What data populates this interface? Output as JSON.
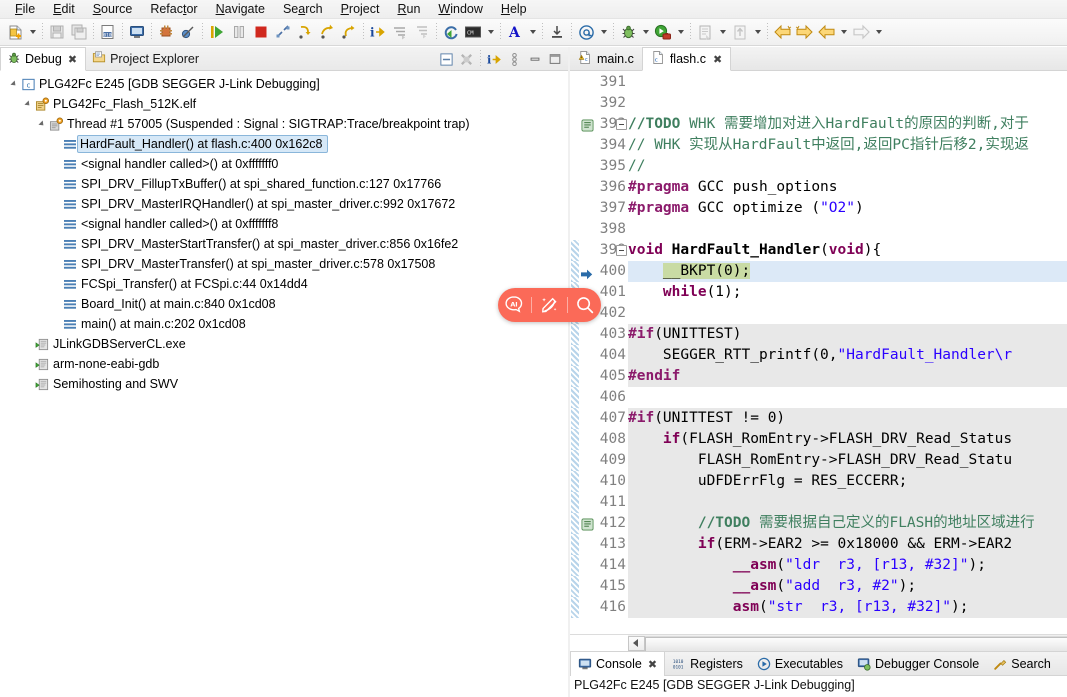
{
  "menubar": {
    "items": [
      {
        "label": "File",
        "mnemonic": "F"
      },
      {
        "label": "Edit",
        "mnemonic": "E"
      },
      {
        "label": "Source",
        "mnemonic": "S"
      },
      {
        "label": "Refactor",
        "mnemonic": "t"
      },
      {
        "label": "Navigate",
        "mnemonic": "N"
      },
      {
        "label": "Search",
        "mnemonic": "a"
      },
      {
        "label": "Project",
        "mnemonic": "P"
      },
      {
        "label": "Run",
        "mnemonic": "R"
      },
      {
        "label": "Window",
        "mnemonic": "W"
      },
      {
        "label": "Help",
        "mnemonic": "H"
      }
    ]
  },
  "toolbar": {
    "buttons": [
      {
        "name": "new-wizard-icon",
        "title": "New"
      },
      {
        "name": "save-icon",
        "title": "Save"
      },
      {
        "name": "save-all-icon",
        "title": "Save All"
      },
      {
        "name": "build-icon",
        "title": "Build"
      },
      {
        "name": "console-icon",
        "title": "Open Console"
      },
      {
        "name": "registers-icon",
        "title": "Registers"
      },
      {
        "name": "skip-breakpoints-icon",
        "title": "Skip All Breakpoints"
      },
      {
        "name": "resume-icon",
        "title": "Resume"
      },
      {
        "name": "suspend-icon",
        "title": "Suspend"
      },
      {
        "name": "terminate-icon",
        "title": "Terminate"
      },
      {
        "name": "disconnect-icon",
        "title": "Disconnect"
      },
      {
        "name": "step-into-icon",
        "title": "Step Into"
      },
      {
        "name": "step-over-icon",
        "title": "Step Over"
      },
      {
        "name": "step-return-icon",
        "title": "Step Return"
      },
      {
        "name": "instruction-stepping-icon",
        "title": "Instruction Stepping Mode"
      },
      {
        "name": "step-into-selection-icon",
        "title": "Step Into Selection"
      },
      {
        "name": "drop-to-frame-icon",
        "title": "Drop To Frame"
      },
      {
        "name": "refresh-icon",
        "title": "Refresh"
      },
      {
        "name": "terminal-icon",
        "title": "Open a Terminal"
      },
      {
        "name": "annotation-icon",
        "title": "Toggle Annotations"
      },
      {
        "name": "export-icon",
        "title": "Export"
      },
      {
        "name": "at-icon",
        "title": "Open Type"
      },
      {
        "name": "debug-bug-icon",
        "title": "Debug"
      },
      {
        "name": "run-external-icon",
        "title": "Run"
      },
      {
        "name": "run-last-tool-icon",
        "title": "External Tools"
      },
      {
        "name": "open-element-icon",
        "title": "Open Element"
      },
      {
        "name": "back-icon",
        "title": "Back"
      },
      {
        "name": "forward-icon",
        "title": "Forward"
      },
      {
        "name": "prev-annotation-icon",
        "title": "Previous Annotation"
      },
      {
        "name": "next-annotation-icon",
        "title": "Next Annotation"
      }
    ]
  },
  "left_view": {
    "tabs": [
      {
        "label": "Debug",
        "active": true,
        "closeable": true,
        "icon": "debug-bug-icon"
      },
      {
        "label": "Project Explorer",
        "active": false,
        "closeable": false,
        "icon": "project-explorer-icon"
      }
    ],
    "view_toolbar": [
      {
        "name": "collapse-all-icon"
      },
      {
        "name": "remove-terminated-icon"
      },
      {
        "name": "instruction-stepping-icon"
      },
      {
        "name": "view-menu-icon"
      },
      {
        "name": "minimize-icon"
      },
      {
        "name": "maximize-icon"
      }
    ],
    "tree": [
      {
        "indent": 0,
        "twisty": "expanded",
        "icon": "launch-config-icon",
        "label": "PLG42Fc E245 [GDB SEGGER J-Link Debugging]",
        "selected": false
      },
      {
        "indent": 1,
        "twisty": "expanded",
        "icon": "process-icon",
        "label": "PLG42Fc_Flash_512K.elf",
        "selected": false
      },
      {
        "indent": 2,
        "twisty": "expanded",
        "icon": "thread-icon",
        "label": "Thread #1 57005 (Suspended : Signal : SIGTRAP:Trace/breakpoint trap)",
        "selected": false
      },
      {
        "indent": 3,
        "twisty": "none",
        "icon": "stackframe-icon",
        "label": "HardFault_Handler() at flash.c:400 0x162c8",
        "selected": true
      },
      {
        "indent": 3,
        "twisty": "none",
        "icon": "stackframe-icon",
        "label": "<signal handler called>() at 0xfffffff0",
        "selected": false
      },
      {
        "indent": 3,
        "twisty": "none",
        "icon": "stackframe-icon",
        "label": "SPI_DRV_FillupTxBuffer() at spi_shared_function.c:127 0x17766",
        "selected": false
      },
      {
        "indent": 3,
        "twisty": "none",
        "icon": "stackframe-icon",
        "label": "SPI_DRV_MasterIRQHandler() at spi_master_driver.c:992 0x17672",
        "selected": false
      },
      {
        "indent": 3,
        "twisty": "none",
        "icon": "stackframe-icon",
        "label": "<signal handler called>() at 0xfffffff8",
        "selected": false
      },
      {
        "indent": 3,
        "twisty": "none",
        "icon": "stackframe-icon",
        "label": "SPI_DRV_MasterStartTransfer() at spi_master_driver.c:856 0x16fe2",
        "selected": false
      },
      {
        "indent": 3,
        "twisty": "none",
        "icon": "stackframe-icon",
        "label": "SPI_DRV_MasterTransfer() at spi_master_driver.c:578 0x17508",
        "selected": false
      },
      {
        "indent": 3,
        "twisty": "none",
        "icon": "stackframe-icon",
        "label": "FCSpi_Transfer() at FCSpi.c:44 0x14dd4",
        "selected": false
      },
      {
        "indent": 3,
        "twisty": "none",
        "icon": "stackframe-icon",
        "label": "Board_Init() at main.c:840 0x1cd08",
        "selected": false
      },
      {
        "indent": 3,
        "twisty": "none",
        "icon": "stackframe-icon",
        "label": "main() at main.c:202 0x1cd08",
        "selected": false
      },
      {
        "indent": 1,
        "twisty": "none",
        "icon": "gdb-process-icon",
        "label": "JLinkGDBServerCL.exe",
        "selected": false
      },
      {
        "indent": 1,
        "twisty": "none",
        "icon": "gdb-process-icon",
        "label": "arm-none-eabi-gdb",
        "selected": false
      },
      {
        "indent": 1,
        "twisty": "none",
        "icon": "gdb-process-icon",
        "label": "Semihosting and SWV",
        "selected": false
      }
    ]
  },
  "editor": {
    "tabs": [
      {
        "label": "main.c",
        "active": false,
        "closeable": false,
        "icon": "c-file-warning-icon"
      },
      {
        "label": "flash.c",
        "active": true,
        "closeable": true,
        "icon": "c-file-icon"
      }
    ],
    "lines": [
      {
        "num": "391",
        "gutter": "",
        "fold": false,
        "bg": "none",
        "tokens": []
      },
      {
        "num": "392",
        "gutter": "",
        "fold": false,
        "bg": "none",
        "tokens": []
      },
      {
        "num": "393",
        "gutter": "todo-task-icon",
        "fold": true,
        "bg": "none",
        "tokens": [
          {
            "t": "//TODO",
            "c": "todo"
          },
          {
            "t": " WHK 需要增加对进入HardFault的原因的判断,对于",
            "c": "cm"
          }
        ]
      },
      {
        "num": "394",
        "gutter": "",
        "fold": false,
        "bg": "none",
        "tokens": [
          {
            "t": "// WHK 实现从HardFault中返回,返回PC指针后移2,实现返",
            "c": "cm"
          }
        ]
      },
      {
        "num": "395",
        "gutter": "",
        "fold": false,
        "bg": "none",
        "tokens": [
          {
            "t": "//",
            "c": "cm"
          }
        ]
      },
      {
        "num": "396",
        "gutter": "",
        "fold": false,
        "bg": "none",
        "tokens": [
          {
            "t": "#pragma",
            "c": "pp"
          },
          {
            "t": " GCC push_options",
            "c": "pl"
          }
        ]
      },
      {
        "num": "397",
        "gutter": "",
        "fold": false,
        "bg": "none",
        "tokens": [
          {
            "t": "#pragma",
            "c": "pp"
          },
          {
            "t": " GCC optimize (",
            "c": "pl"
          },
          {
            "t": "\"O2\"",
            "c": "str"
          },
          {
            "t": ")",
            "c": "pl"
          }
        ]
      },
      {
        "num": "398",
        "gutter": "",
        "fold": false,
        "bg": "none",
        "tokens": []
      },
      {
        "num": "399",
        "gutter": "",
        "fold": true,
        "bg": "none",
        "ruler": true,
        "tokens": [
          {
            "t": "void",
            "c": "kw"
          },
          {
            "t": " ",
            "c": "pl"
          },
          {
            "t": "HardFault_Handler",
            "c": "fn"
          },
          {
            "t": "(",
            "c": "pl"
          },
          {
            "t": "void",
            "c": "kw"
          },
          {
            "t": "){",
            "c": "pl"
          }
        ]
      },
      {
        "num": "400",
        "gutter": "exec-arrow-icon",
        "fold": false,
        "bg": "exec",
        "ruler": true,
        "tokens": [
          {
            "t": "    ",
            "c": "pl"
          },
          {
            "t": "__BKPT(0);",
            "c": "pl",
            "hl": true
          }
        ]
      },
      {
        "num": "401",
        "gutter": "",
        "fold": false,
        "bg": "none",
        "ruler": true,
        "tokens": [
          {
            "t": "    ",
            "c": "pl"
          },
          {
            "t": "while",
            "c": "kw"
          },
          {
            "t": "(1);",
            "c": "pl"
          }
        ]
      },
      {
        "num": "402",
        "gutter": "",
        "fold": false,
        "bg": "none",
        "ruler": true,
        "tokens": []
      },
      {
        "num": "403",
        "gutter": "",
        "fold": false,
        "bg": "inactive",
        "ruler": true,
        "tokens": [
          {
            "t": "#if",
            "c": "pp"
          },
          {
            "t": "(UNITTEST)",
            "c": "pl"
          }
        ]
      },
      {
        "num": "404",
        "gutter": "",
        "fold": false,
        "bg": "inactive",
        "ruler": true,
        "tokens": [
          {
            "t": "    SEGGER_RTT_printf(0,",
            "c": "pl"
          },
          {
            "t": "\"HardFault_Handler\\r",
            "c": "str"
          }
        ]
      },
      {
        "num": "405",
        "gutter": "",
        "fold": false,
        "bg": "inactive",
        "ruler": true,
        "tokens": [
          {
            "t": "#endif",
            "c": "pp"
          }
        ]
      },
      {
        "num": "406",
        "gutter": "",
        "fold": false,
        "bg": "none",
        "ruler": true,
        "tokens": []
      },
      {
        "num": "407",
        "gutter": "",
        "fold": false,
        "bg": "inactive",
        "ruler": true,
        "tokens": [
          {
            "t": "#if",
            "c": "pp"
          },
          {
            "t": "(UNITTEST != 0)",
            "c": "pl"
          }
        ]
      },
      {
        "num": "408",
        "gutter": "",
        "fold": false,
        "bg": "inactive",
        "ruler": true,
        "tokens": [
          {
            "t": "    ",
            "c": "pl"
          },
          {
            "t": "if",
            "c": "kw"
          },
          {
            "t": "(FLASH_RomEntry->FLASH_DRV_Read_Status",
            "c": "pl"
          }
        ]
      },
      {
        "num": "409",
        "gutter": "",
        "fold": false,
        "bg": "inactive",
        "ruler": true,
        "tokens": [
          {
            "t": "        FLASH_RomEntry->FLASH_DRV_Read_Statu",
            "c": "pl"
          }
        ]
      },
      {
        "num": "410",
        "gutter": "",
        "fold": false,
        "bg": "inactive",
        "ruler": true,
        "tokens": [
          {
            "t": "        uDFDErrFlg = RES_ECCERR;",
            "c": "pl"
          }
        ]
      },
      {
        "num": "411",
        "gutter": "",
        "fold": false,
        "bg": "inactive",
        "ruler": true,
        "tokens": []
      },
      {
        "num": "412",
        "gutter": "todo-task-icon",
        "fold": false,
        "bg": "inactive",
        "ruler": true,
        "tokens": [
          {
            "t": "        ",
            "c": "pl"
          },
          {
            "t": "//TODO",
            "c": "todo"
          },
          {
            "t": " 需要根据自己定义的FLASH的地址区域进行",
            "c": "cm"
          }
        ]
      },
      {
        "num": "413",
        "gutter": "",
        "fold": false,
        "bg": "inactive",
        "ruler": true,
        "tokens": [
          {
            "t": "        ",
            "c": "pl"
          },
          {
            "t": "if",
            "c": "kw"
          },
          {
            "t": "(ERM->EAR2 >= 0x18000 && ERM->EAR2",
            "c": "pl"
          }
        ]
      },
      {
        "num": "414",
        "gutter": "",
        "fold": false,
        "bg": "inactive",
        "ruler": true,
        "tokens": [
          {
            "t": "            ",
            "c": "pl"
          },
          {
            "t": "__asm",
            "c": "kw"
          },
          {
            "t": "(",
            "c": "pl"
          },
          {
            "t": "\"ldr  r3, [r13, #32]\"",
            "c": "str"
          },
          {
            "t": ");",
            "c": "pl"
          }
        ]
      },
      {
        "num": "415",
        "gutter": "",
        "fold": false,
        "bg": "inactive",
        "ruler": true,
        "tokens": [
          {
            "t": "            ",
            "c": "pl"
          },
          {
            "t": "__asm",
            "c": "kw"
          },
          {
            "t": "(",
            "c": "pl"
          },
          {
            "t": "\"add  r3, #2\"",
            "c": "str"
          },
          {
            "t": ");",
            "c": "pl"
          }
        ]
      },
      {
        "num": "416",
        "gutter": "",
        "fold": false,
        "bg": "inactive",
        "ruler": true,
        "tokens": [
          {
            "t": "            ",
            "c": "pl"
          },
          {
            "t": "asm",
            "c": "kw"
          },
          {
            "t": "(",
            "c": "pl"
          },
          {
            "t": "\"str  r3, [r13, #32]\"",
            "c": "str"
          },
          {
            "t": ");",
            "c": "pl"
          }
        ]
      }
    ]
  },
  "bottom_view": {
    "tabs": [
      {
        "label": "Console",
        "active": true,
        "closeable": true,
        "icon": "console-icon"
      },
      {
        "label": "Registers",
        "active": false,
        "closeable": false,
        "icon": "registers-icon"
      },
      {
        "label": "Executables",
        "active": false,
        "closeable": false,
        "icon": "executables-icon"
      },
      {
        "label": "Debugger Console",
        "active": false,
        "closeable": false,
        "icon": "debugger-console-icon"
      },
      {
        "label": "Search",
        "active": false,
        "closeable": false,
        "icon": "search-icon"
      }
    ],
    "content": "PLG42Fc E245 [GDB SEGGER J-Link Debugging]"
  },
  "ai_toolbar": {
    "background": "#fb6a58",
    "buttons": [
      {
        "name": "ai-chat-icon",
        "label": "AI"
      },
      {
        "name": "magic-wand-icon",
        "label": ""
      },
      {
        "name": "search-icon",
        "label": ""
      }
    ]
  },
  "colors": {
    "selection_blue": "#d6e8f7",
    "exec_line_green": "#c9dba4",
    "exec_line_blue": "#dce9f7",
    "inactive_code_gray": "#e8e8e8",
    "comment_green": "#3f7f5f",
    "keyword_purple": "#7f0055",
    "string_blue": "#2a00ff",
    "preproc_magenta": "#8b1a6b"
  }
}
